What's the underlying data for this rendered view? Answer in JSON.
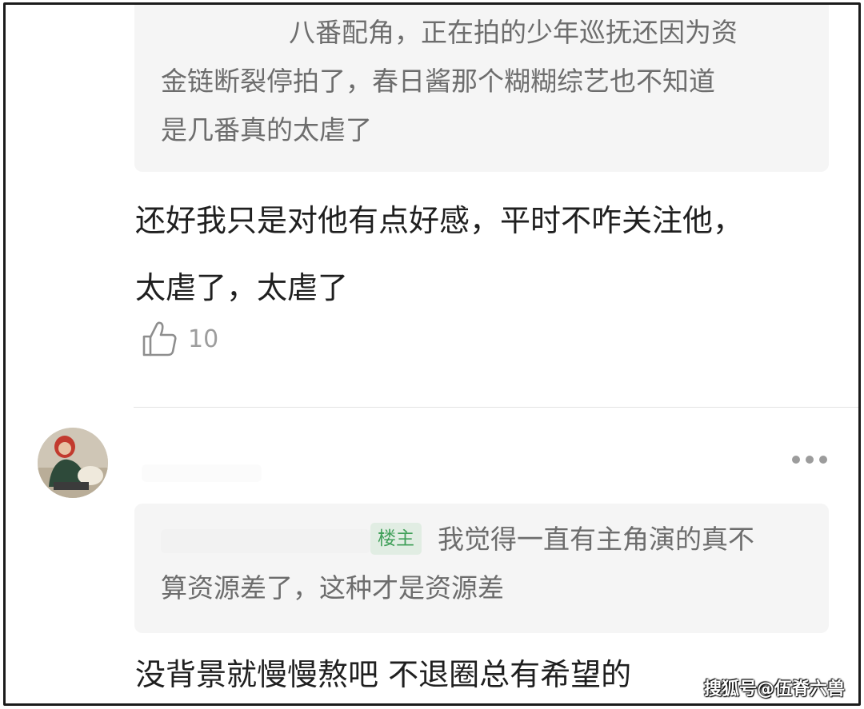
{
  "comment1": {
    "quote_lines": [
      "八番配角，正在拍的少年巡抚还因为资",
      "金链断裂停拍了，春日酱那个糊糊综艺也不知道",
      "是几番真的太虐了"
    ],
    "text_lines": [
      "还好我只是对他有点好感，平时不咋关注他，",
      "太虐了，太虐了"
    ],
    "like_count": "10"
  },
  "comment2": {
    "quote": {
      "badge": "楼主",
      "line1": "我觉得一直有主角演的真不",
      "line2": "算资源差了，这种才是资源差"
    },
    "text": "没背景就慢慢熬吧 不退圈总有希望的"
  },
  "watermark": "搜狐号@伍脊六兽",
  "icons": {
    "like": "thumbs-up-icon",
    "more": "more-dots-icon"
  },
  "colors": {
    "quote_bg": "#f5f5f5",
    "badge_bg": "#e1ede3",
    "badge_text": "#41a05a"
  }
}
